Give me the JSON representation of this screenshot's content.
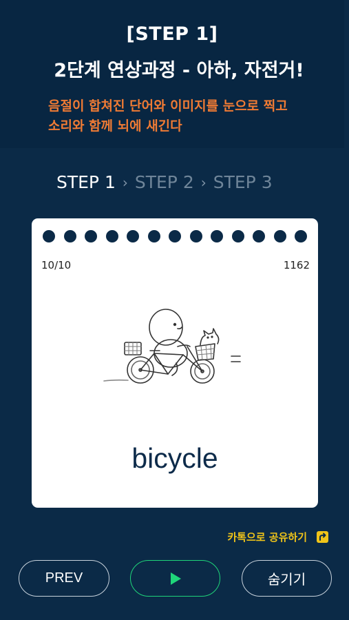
{
  "header": {
    "title_line1": "[STEP 1]",
    "title_line2": "2단계 연상과정 - 아하, 자전거!",
    "subtitle_line1": "음절이 합쳐진 단어와 이미지를 눈으로 찍고",
    "subtitle_line2": "소리와 함께 뇌에 새긴다"
  },
  "steps": {
    "step1": "STEP 1",
    "step2": "STEP 2",
    "step3": "STEP 3"
  },
  "card": {
    "counter": "10/10",
    "word_id": "1162",
    "word": "bicycle",
    "illustration_icon": "cyclist-with-cat-basket-icon"
  },
  "share": {
    "label": "카톡으로 공유하기",
    "icon": "share-arrow-icon"
  },
  "controls": {
    "prev_label": "PREV",
    "play_icon": "play-icon",
    "hide_label": "숨기기"
  },
  "colors": {
    "background": "#0b2a47",
    "accent_orange": "#f07b34",
    "accent_yellow": "#f0c419",
    "play_green": "#1fd67a"
  }
}
